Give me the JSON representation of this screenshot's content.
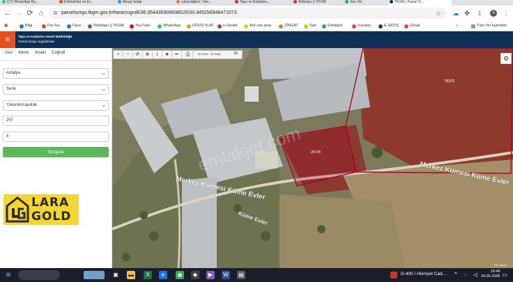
{
  "browser": {
    "tabs": [
      {
        "label": "(17) WhatsApp Bu..."
      },
      {
        "label": "Erikkaklılar ve Er..."
      },
      {
        "label": "Meşaj Setajı"
      },
      {
        "label": "yukarılağem / Ser..."
      },
      {
        "label": "Tapu ve Kadastro..."
      },
      {
        "label": "Webtapu || TKGM"
      },
      {
        "label": "Sen Yer"
      },
      {
        "label": "TKGM | Parsel S..."
      }
    ],
    "url": "parselsorgu.tkgm.gov.tr/#ara/cografi/36.954435909938525/30.945256948471073",
    "profile_initial": "S",
    "bookmarks": [
      {
        "label": "Bilgi",
        "color": "#1a73e8"
      },
      {
        "label": "Par.Scr.",
        "color": "#e84f20"
      },
      {
        "label": "Face",
        "color": "#1877f2"
      },
      {
        "label": "Webtapu || TKGM",
        "color": "#c0392b"
      },
      {
        "label": "YouTube",
        "color": "#ff0000"
      },
      {
        "label": "WhatsApp",
        "color": "#25d366"
      },
      {
        "label": "DÖVİZ KUR",
        "color": "#f39c12"
      },
      {
        "label": "e-Devlet",
        "color": "#c0392b"
      },
      {
        "label": "Arıt satı arsa",
        "color": "#f1c40f"
      },
      {
        "label": "ZİNGAT",
        "color": "#e67e22"
      },
      {
        "label": "Sah",
        "color": "#f1c40f"
      },
      {
        "label": "Emlakjet",
        "color": "#27ae60"
      },
      {
        "label": "Icecami",
        "color": "#e74c3c"
      },
      {
        "label": "E-SATIŞ",
        "color": "#2c3e50"
      },
      {
        "label": "Gmail",
        "color": "#ea4335"
      }
    ],
    "bookmarks_right": "Tüm Yer İşaretleri"
  },
  "app": {
    "title_line1": "Tapu ve Kadastro Genel Müdürlüğü",
    "title_line2": "Parsel Sorgu Uygulaması",
    "menu_icon": "hamburger-icon"
  },
  "sidebar": {
    "tabs": [
      "İdari",
      "Adres",
      "Analiz",
      "Coğrafi"
    ],
    "active_tab": "İdari",
    "il": "Antalya",
    "ilce": "Serik",
    "mahalle": "Yukarıkocayatak",
    "ada": "257",
    "parsel": "8",
    "query_button": "Sorgula"
  },
  "map": {
    "coordinate_readout": "36.9526 - 30.9448",
    "zoom_level": "18",
    "parcel_labels": [
      "257/8",
      "252/3"
    ],
    "road_labels": [
      "Merkez Kümesi Küme Evler",
      "Merkez Kümesi Küme Evler",
      "Küme Evler"
    ],
    "watermark": "emlakjet.com",
    "attribution": "Esri, Maxar"
  },
  "logo": {
    "text1": "LARA",
    "text2": "GOLD"
  },
  "taskbar": {
    "news": "D-400 / Hürriyet Cad...",
    "time": "15:46",
    "date": "24.05.2025"
  },
  "colors": {
    "header": "#0f2f54",
    "menu_accent": "#e84f20",
    "query_button": "#5cb85c",
    "parcel_outline": "#b0002a",
    "logo_bg": "#f3d534"
  }
}
